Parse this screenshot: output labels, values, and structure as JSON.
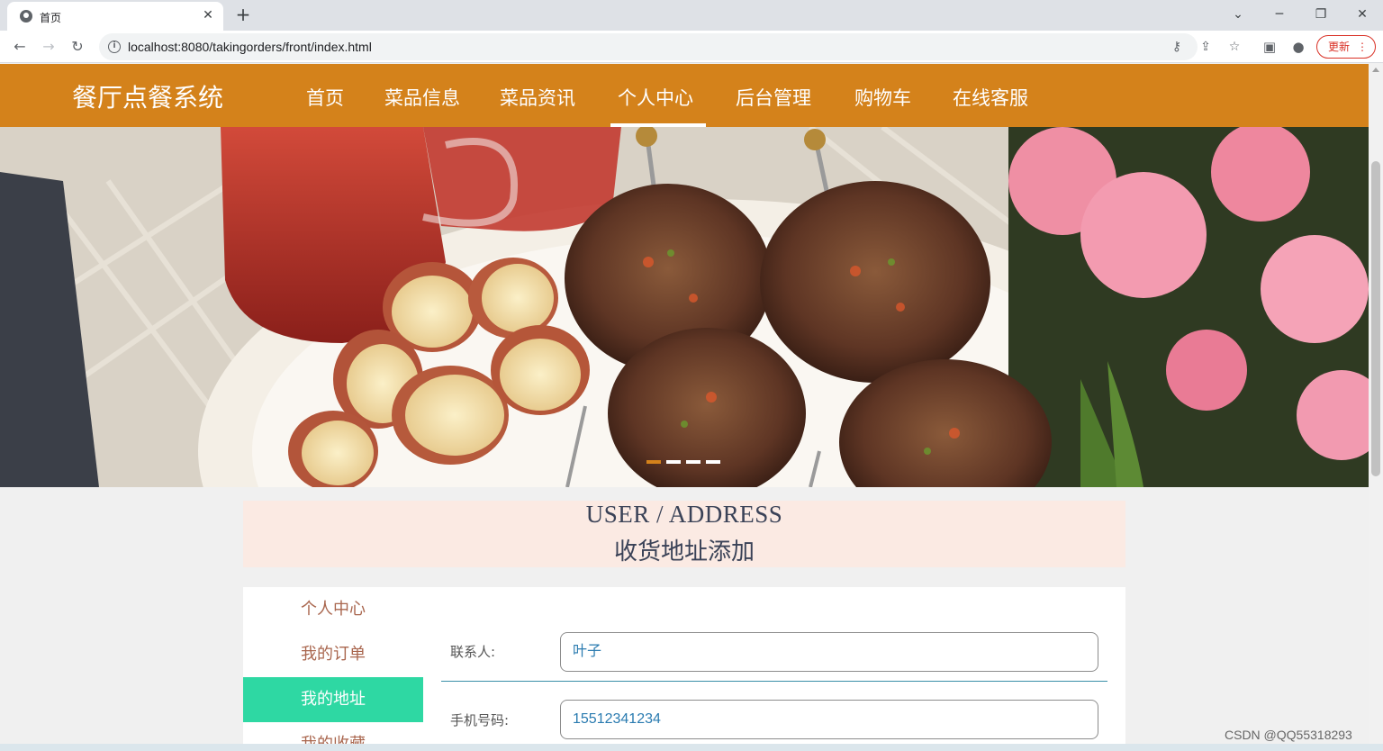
{
  "browser": {
    "tab_title": "首页",
    "url": "localhost:8080/takingorders/front/index.html",
    "update_label": "更新"
  },
  "site": {
    "title": "餐厅点餐系统",
    "nav": [
      {
        "label": "首页"
      },
      {
        "label": "菜品信息"
      },
      {
        "label": "菜品资讯"
      },
      {
        "label": "个人中心",
        "active": true
      },
      {
        "label": "后台管理"
      },
      {
        "label": "购物车"
      },
      {
        "label": "在线客服"
      }
    ],
    "brand_color": "#d4821b"
  },
  "banner": {
    "slides": 4,
    "active_slide": 1
  },
  "section": {
    "title_en": "USER / ADDRESS",
    "title_cn": "收货地址添加"
  },
  "sidebar": {
    "items": [
      {
        "label": "个人中心"
      },
      {
        "label": "我的订单"
      },
      {
        "label": "我的地址",
        "active": true
      },
      {
        "label": "我的收藏"
      }
    ],
    "active_color": "#2ed8a3"
  },
  "form": {
    "contact_label": "联系人:",
    "contact_value": "叶子",
    "phone_label": "手机号码:",
    "phone_value": "15512341234"
  },
  "watermark": "CSDN @QQ55318293"
}
